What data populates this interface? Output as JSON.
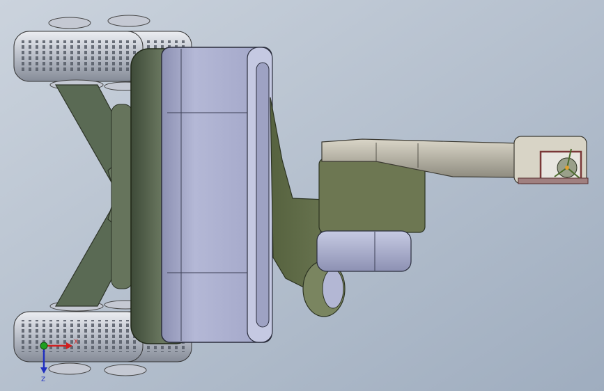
{
  "viewport": {
    "background_top": "#c9d2dd",
    "background_bottom": "#a9b6c6"
  },
  "colors": {
    "body_main": "#a9adcc",
    "body_dark": "#8a8fb4",
    "frame_olive": "#5f6e52",
    "frame_dark": "#45503c",
    "arm_olive": "#6a7550",
    "arm_grey": "#b5b2a6",
    "tyre_light": "#d0d4dc",
    "tyre_dark": "#9aa0ab",
    "bracket_red": "#8a5a5a",
    "gripper_orange": "#e0a030",
    "axis_x": "#d02020",
    "axis_y": "#20a020",
    "axis_z": "#2030c0"
  },
  "triad": {
    "x_label": "X",
    "z_label": "Z"
  }
}
